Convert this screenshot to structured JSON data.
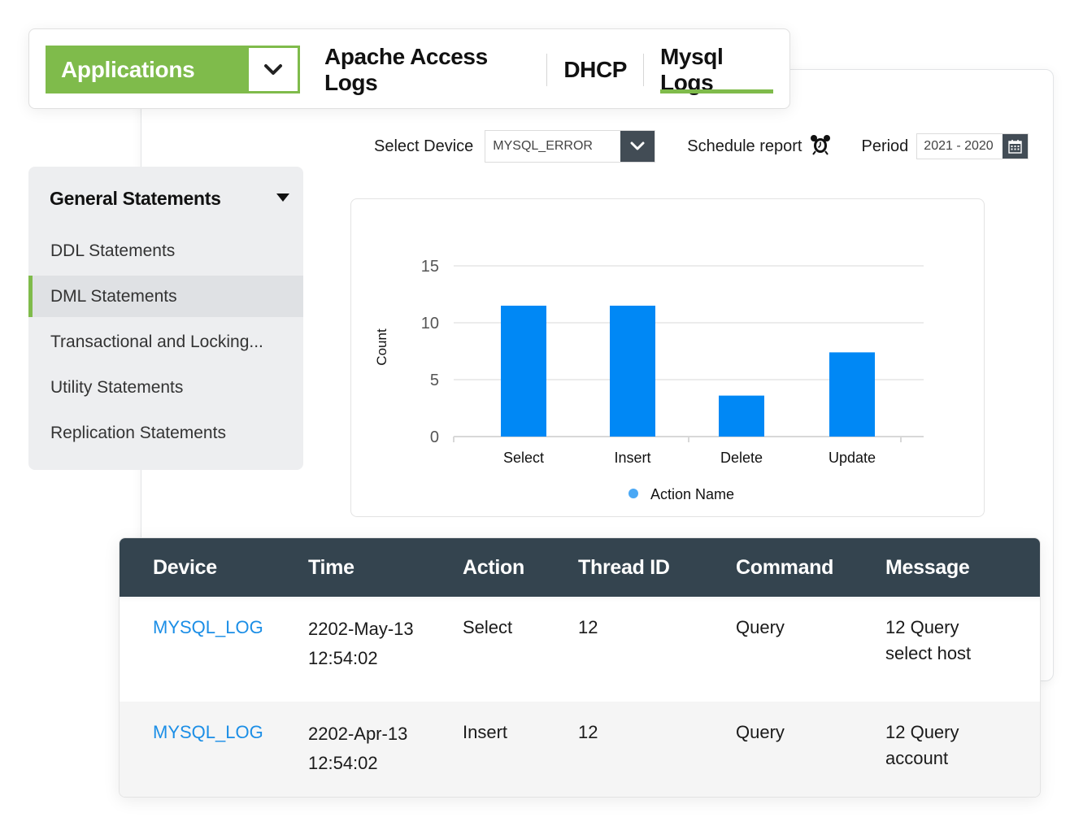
{
  "nav": {
    "app_selector": "Applications",
    "tabs": [
      {
        "label": "Apache Access Logs",
        "active": false
      },
      {
        "label": "DHCP",
        "active": false
      },
      {
        "label": "Mysql Logs",
        "active": true
      }
    ]
  },
  "toolbar": {
    "select_device_label": "Select Device",
    "device_value": "MYSQL_ERROR",
    "schedule_label": "Schedule report",
    "period_label": "Period",
    "period_value": "2021 - 2020"
  },
  "sidebar": {
    "header": "General Statements",
    "items": [
      {
        "label": "DDL Statements",
        "active": false
      },
      {
        "label": "DML Statements",
        "active": true
      },
      {
        "label": "Transactional and Locking...",
        "active": false
      },
      {
        "label": "Utility Statements",
        "active": false
      },
      {
        "label": "Replication Statements",
        "active": false
      }
    ]
  },
  "colors": {
    "accent_green": "#7fbb4b",
    "bar_blue": "#0088f5",
    "legend_dot": "#4aa8f5",
    "table_header": "#34444f",
    "link_blue": "#1b8ee6"
  },
  "chart_data": {
    "type": "bar",
    "title": "",
    "xlabel": "",
    "ylabel": "Count",
    "categories": [
      "Select",
      "Insert",
      "Delete",
      "Update"
    ],
    "values": [
      11.5,
      11.5,
      3.6,
      7.4
    ],
    "ylim": [
      0,
      15
    ],
    "yticks": [
      0,
      5,
      10,
      15
    ],
    "grid": true,
    "legend": {
      "entries": [
        "Action Name"
      ],
      "placement": "bottom"
    }
  },
  "table": {
    "columns": [
      "Device",
      "Time",
      "Action",
      "Thread ID",
      "Command",
      "Message"
    ],
    "rows": [
      {
        "device": "MYSQL_LOG",
        "date": "2202-May-13",
        "time": "12:54:02",
        "action": "Select",
        "thread_id": "12",
        "command": "Query",
        "message_1": "12 Query",
        "message_2": "select host"
      },
      {
        "device": "MYSQL_LOG",
        "date": "2202-Apr-13",
        "time": "12:54:02",
        "action": "Insert",
        "thread_id": "12",
        "command": "Query",
        "message_1": "12 Query",
        "message_2": "account"
      }
    ]
  }
}
